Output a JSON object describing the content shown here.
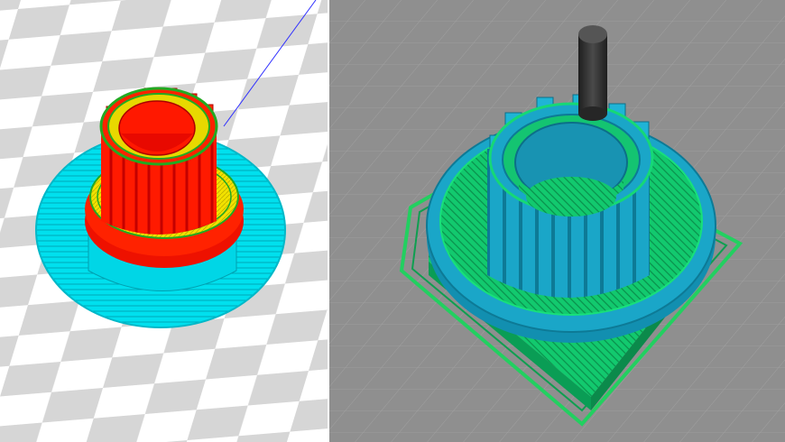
{
  "panels": [
    {
      "id": "left",
      "viewer_theme": "light",
      "bed_pattern": "checkerboard",
      "bed_colors": [
        "#ffffff",
        "#d4d4d4"
      ],
      "colors": {
        "outer_wall": "#ff0000",
        "inner_wall": "#22aa22",
        "top_bottom_infill": "#f0e000",
        "support_skirt": "#00e6f0",
        "travel_line": "#3030ff"
      }
    },
    {
      "id": "right",
      "viewer_theme": "dark",
      "bed_pattern": "grid",
      "bed_colors": [
        "#8f8f8f",
        "#a6a6a6"
      ],
      "colors": {
        "walls": "#1aa6c8",
        "infill": "#14e27a",
        "support": "#0fbd6a",
        "skirt": "#22d060",
        "nozzle": "#2b2b2b"
      }
    }
  ]
}
